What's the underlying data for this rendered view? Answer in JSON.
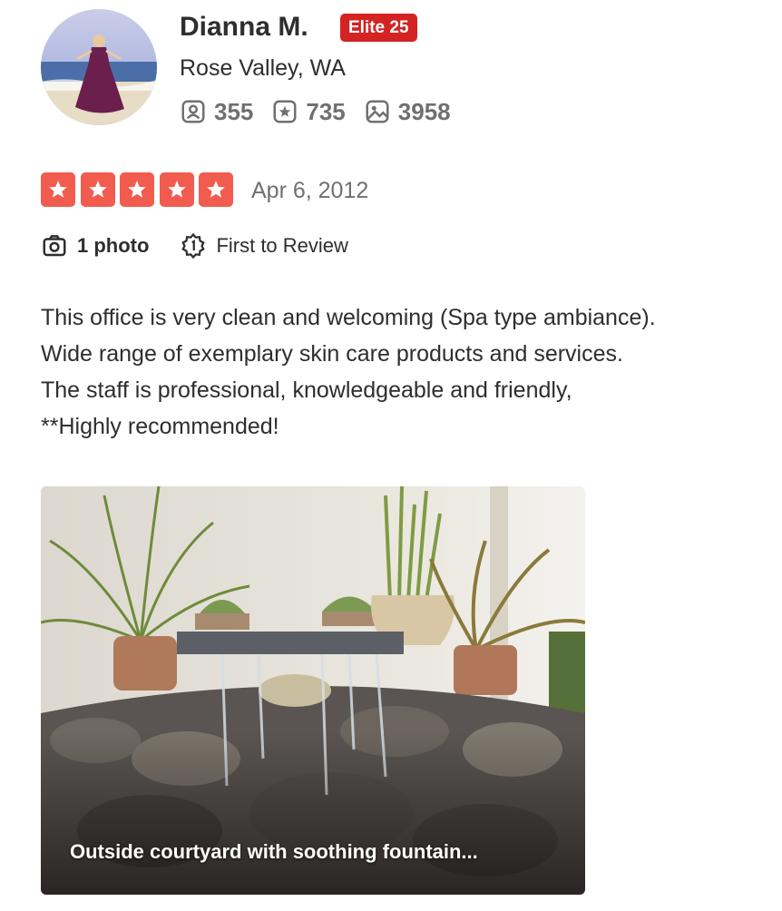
{
  "user": {
    "name": "Dianna M.",
    "elite_badge": "Elite 25",
    "location": "Rose Valley, WA",
    "stats": {
      "friends": "355",
      "reviews": "735",
      "photos": "3958"
    }
  },
  "review": {
    "rating": 5,
    "date": "Apr 6, 2012",
    "photo_count_label": "1 photo",
    "first_to_review_label": "First to Review",
    "text_lines": [
      "This office is very clean and welcoming (Spa type ambiance).",
      "Wide range of exemplary skin care products and services.",
      "The staff is professional, knowledgeable and friendly,",
      "**Highly recommended!"
    ],
    "photo_caption": "Outside courtyard with soothing fountain..."
  },
  "colors": {
    "star_red": "#f15c4f",
    "elite_red": "#d32323",
    "text_dark": "#2d2e2f",
    "text_gray": "#6e7072"
  },
  "icons": {
    "friends": "friends-icon",
    "reviews": "review-star-icon",
    "photos": "photo-icon",
    "camera": "camera-icon",
    "first_review": "first-to-review-icon"
  }
}
